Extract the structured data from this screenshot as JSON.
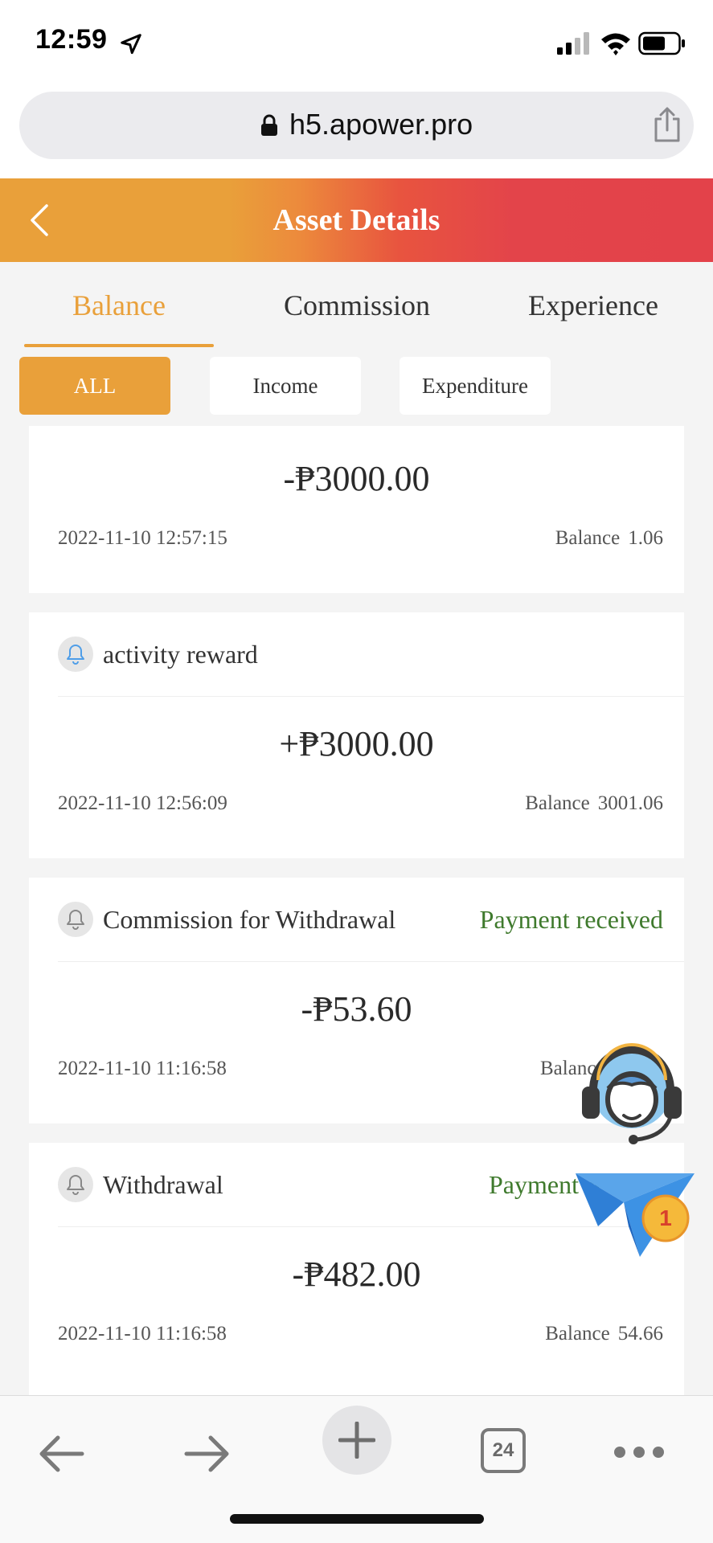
{
  "status_bar": {
    "time": "12:59"
  },
  "browser": {
    "url": "h5.apower.pro",
    "tab_count": "24"
  },
  "header": {
    "title": "Asset Details"
  },
  "tabs": [
    {
      "label": "Balance",
      "active": true
    },
    {
      "label": "Commission",
      "active": false
    },
    {
      "label": "Experience",
      "active": false
    }
  ],
  "filters": [
    {
      "label": "ALL",
      "active": true
    },
    {
      "label": "Income",
      "active": false
    },
    {
      "label": "Expenditure",
      "active": false
    }
  ],
  "transactions": [
    {
      "type": "",
      "status": "",
      "amount": "-₱3000.00",
      "datetime": "2022-11-10 12:57:15",
      "balance_label": "Balance",
      "balance": "1.06"
    },
    {
      "type": "activity reward",
      "status": "",
      "amount": "+₱3000.00",
      "datetime": "2022-11-10 12:56:09",
      "balance_label": "Balance",
      "balance": "3001.06",
      "icon_color": "#4f9ee8"
    },
    {
      "type": "Commission for Withdrawal",
      "status": "Payment received",
      "amount": "-₱53.60",
      "datetime": "2022-11-10 11:16:58",
      "balance_label": "Balance",
      "balance": "",
      "icon_color": "#888888"
    },
    {
      "type": "Withdrawal",
      "status": "Payment re",
      "amount": "-₱482.00",
      "datetime": "2022-11-10 11:16:58",
      "balance_label": "Balance",
      "balance": "54.66",
      "icon_color": "#888888"
    }
  ],
  "widgets": {
    "notification_badge": "1"
  },
  "colors": {
    "accent": "#e9a03a",
    "header_end": "#e3424a",
    "status_green": "#3f7a2d"
  }
}
